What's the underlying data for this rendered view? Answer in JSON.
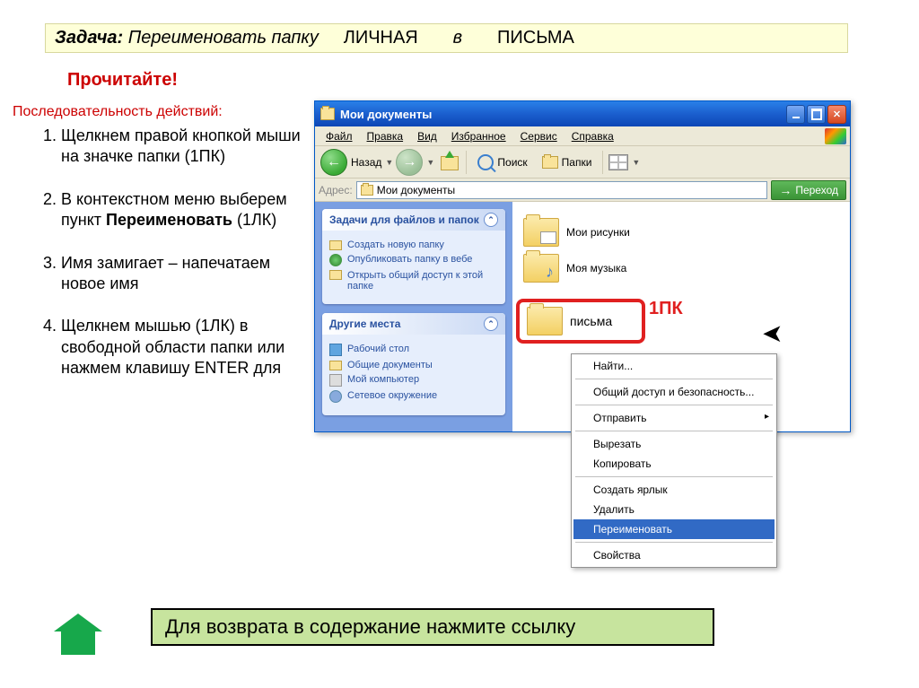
{
  "task": {
    "label": "Задача:",
    "action": "Переименовать папку",
    "from": "ЛИЧНАЯ",
    "sep": "в",
    "to": "ПИСЬМА"
  },
  "readHeading": "Прочитайте!",
  "sequenceLabel": "Последовательность действий:",
  "steps": {
    "s1": "Щелкнем правой кнопкой мыши на значке папки (1ПК)",
    "s2a": "В контекстном меню выберем пункт ",
    "s2b": "Переименовать",
    "s2c": " (1ЛК)",
    "s3": "Имя замигает – напечатаем новое имя",
    "s4": "Щелкнем мышью (1ЛК) в свободной области папки или нажмем клавишу ENTER для"
  },
  "explorer": {
    "title": "Мои документы",
    "menu": {
      "file": "Файл",
      "edit": "Правка",
      "view": "Вид",
      "fav": "Избранное",
      "tools": "Сервис",
      "help": "Справка"
    },
    "toolbar": {
      "back": "Назад",
      "search": "Поиск",
      "folders": "Папки"
    },
    "address": {
      "label": "Адрес:",
      "value": "Мои документы",
      "go": "Переход"
    },
    "panels": {
      "tasksHeader": "Задачи для файлов и папок",
      "tasks": {
        "create": "Создать новую папку",
        "publish": "Опубликовать папку в вебе",
        "share": "Открыть общий доступ к этой папке"
      },
      "placesHeader": "Другие места",
      "places": {
        "desktop": "Рабочий стол",
        "shared": "Общие документы",
        "computer": "Мой компьютер",
        "network": "Сетевое окружение"
      }
    },
    "files": {
      "pictures": "Мои рисунки",
      "music": "Моя музыка",
      "letters": "письма"
    },
    "clickAnnotation": "1ПК"
  },
  "contextMenu": {
    "find": "Найти...",
    "security": "Общий доступ и безопасность...",
    "send": "Отправить",
    "cut": "Вырезать",
    "copy": "Копировать",
    "shortcut": "Создать ярлык",
    "delete": "Удалить",
    "rename": "Переименовать",
    "props": "Свойства"
  },
  "footer": "Для возврата в содержание нажмите ссылку"
}
